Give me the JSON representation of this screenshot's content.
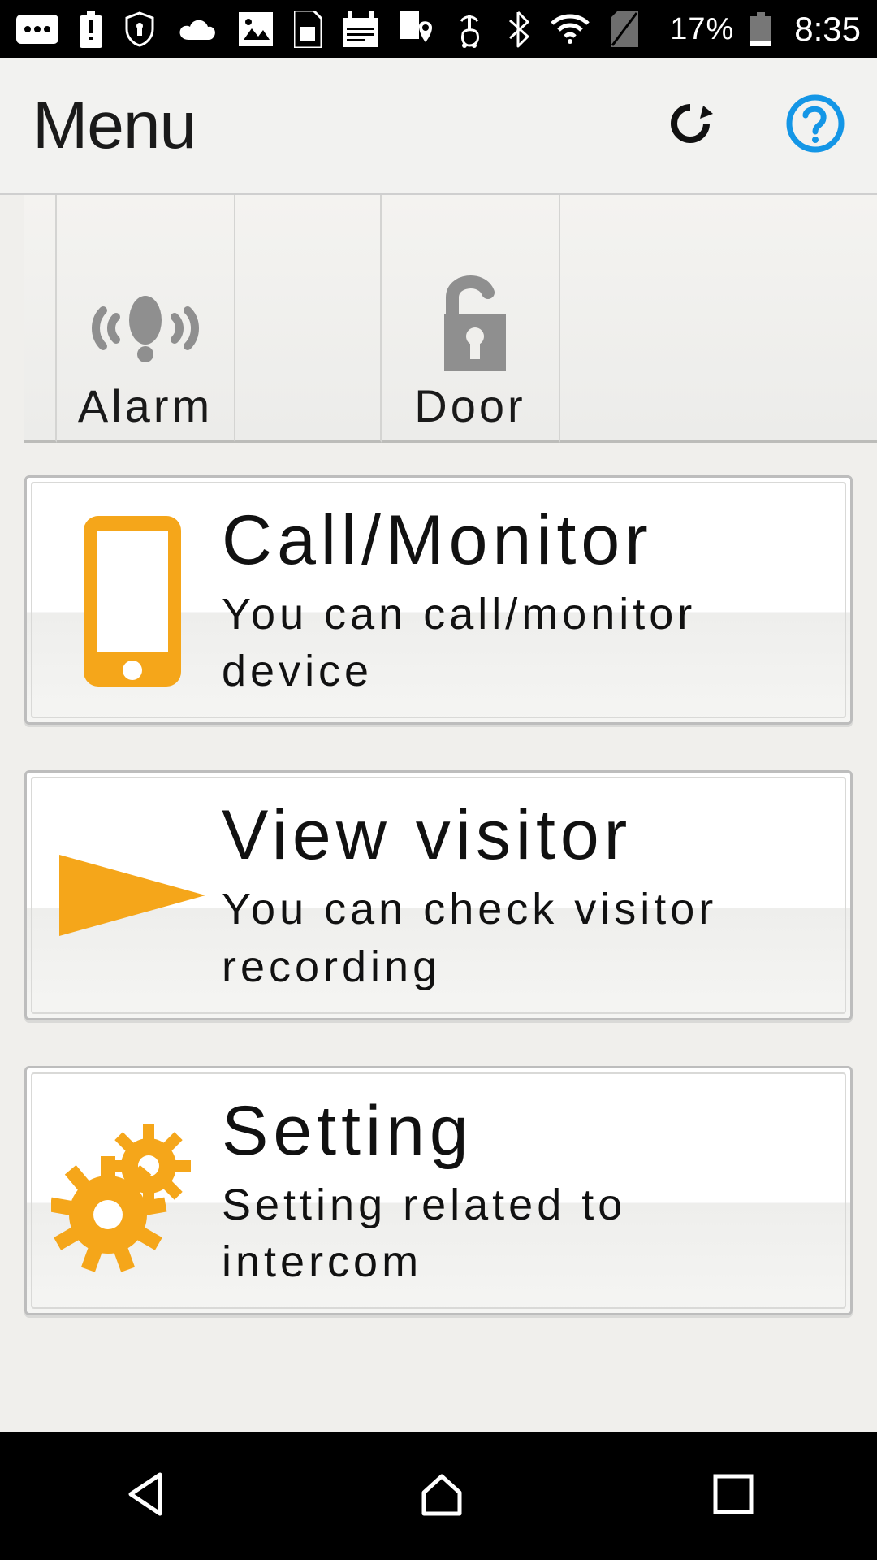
{
  "statusbar": {
    "battery_pct": "17%",
    "clock": "8:35"
  },
  "header": {
    "title": "Menu"
  },
  "tabs": {
    "alarm_label": "Alarm",
    "door_label": "Door"
  },
  "cards": {
    "call": {
      "title": "Call/Monitor",
      "desc": "You can call/monitor device"
    },
    "view": {
      "title": "View visitor",
      "desc": "You can check visitor recording"
    },
    "setting": {
      "title": "Setting",
      "desc": "Setting related to intercom"
    }
  }
}
